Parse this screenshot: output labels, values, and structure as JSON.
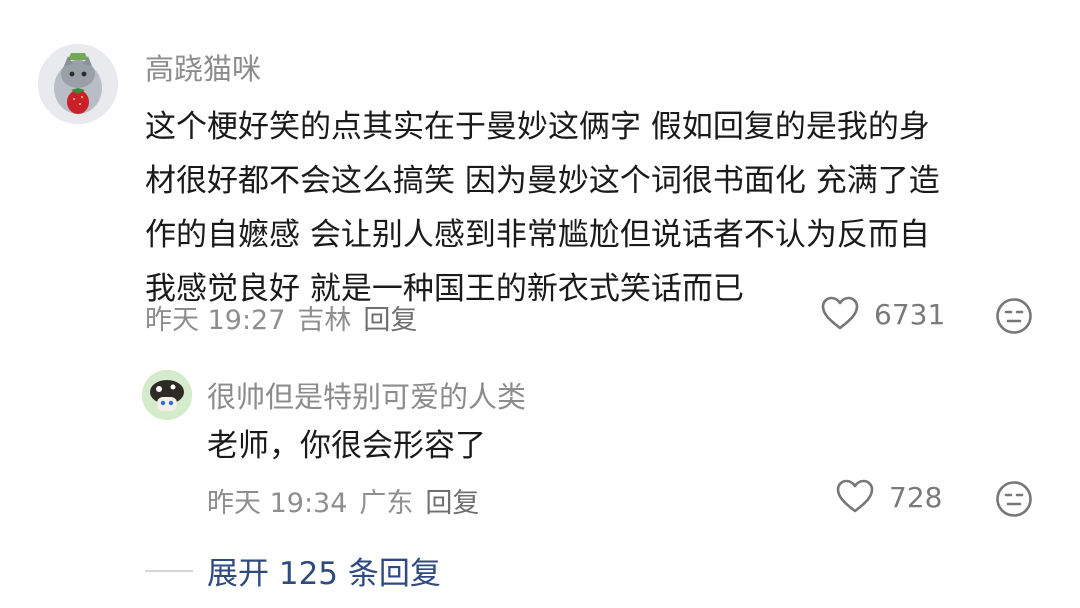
{
  "comments": [
    {
      "author": "高跷猫咪",
      "content_lines": [
        "这个梗好笑的点其实在于曼妙这俩字 假如回复的是我的身",
        "材很好都不会这么搞笑 因为曼妙这个词很书面化 充满了造",
        "作的自嬷感  会让别人感到非常尴尬但说话者不认为反而自",
        "我感觉良好 就是一种国王的新衣式笑话而已"
      ],
      "time": "昨天 19:27",
      "location": "吉林",
      "reply_label": "回复",
      "likes": "6731",
      "avatar_icon": "gray-cat-with-strawberry-avatar"
    },
    {
      "author": "很帅但是特别可爱的人类",
      "content_lines": [
        "老师，你很会形容了"
      ],
      "time": "昨天 19:34",
      "location": "广东",
      "reply_label": "回复",
      "likes": "728",
      "avatar_icon": "cartoon-mushroom-avatar"
    }
  ],
  "expand_replies": "展开 125 条回复",
  "colors": {
    "author": "#8c8c8c",
    "meta": "#8e8e8e",
    "expand_link": "#2f4a7f",
    "icon": "#777777"
  }
}
